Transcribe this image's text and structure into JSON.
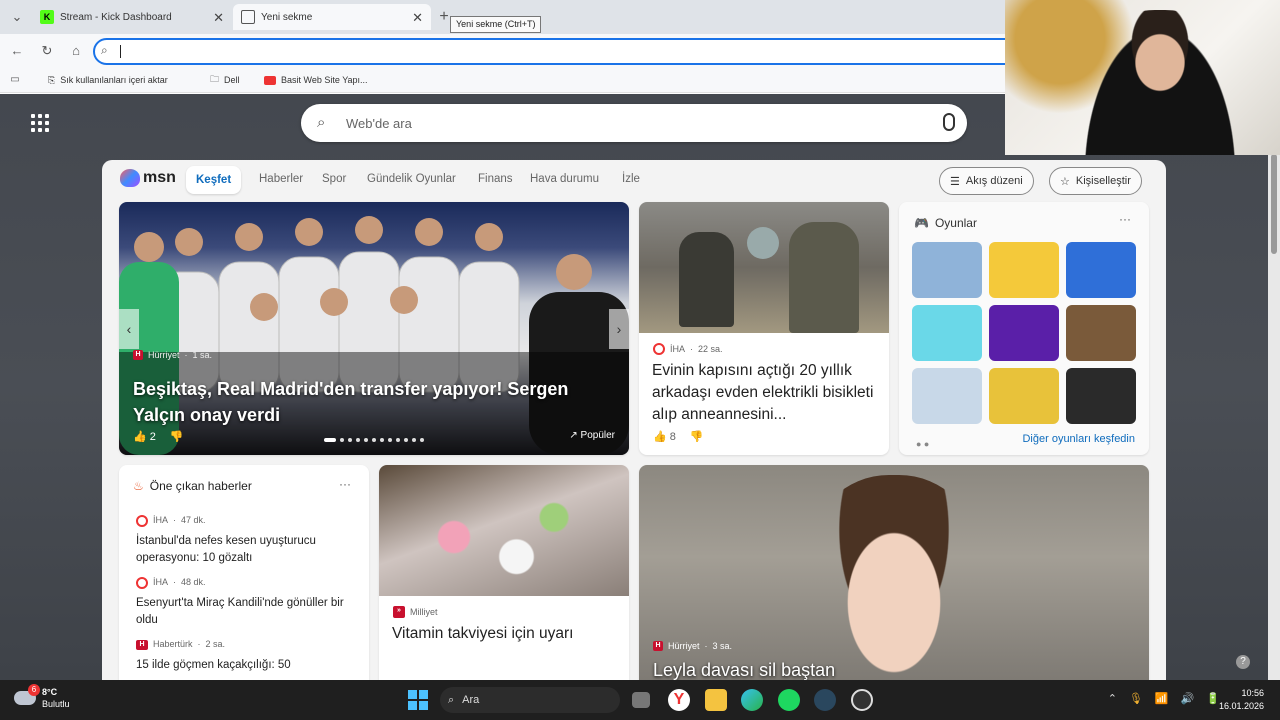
{
  "tabs": [
    {
      "label": "Stream - Kick Dashboard",
      "icon": "kick-icon",
      "color": "#53fc18"
    },
    {
      "label": "Yeni sekme",
      "icon": "newtab-icon"
    }
  ],
  "tooltip": "Yeni sekme (Ctrl+T)",
  "address": {
    "value": ""
  },
  "bookmarks": [
    {
      "label": "Sık kullanılanları içeri aktar",
      "icon": "import-icon"
    },
    {
      "label": "Dell",
      "icon": "folder-icon"
    },
    {
      "label": "Basit Web Site Yapı...",
      "icon": "youtube-icon"
    }
  ],
  "search": {
    "placeholder": "Web'de ara"
  },
  "msn": {
    "logo": "msn",
    "nav": [
      "Keşfet",
      "Haberler",
      "Spor",
      "Gündelik Oyunlar",
      "Finans",
      "Hava durumu",
      "İzle"
    ],
    "buttons": {
      "layout": "Akış düzeni",
      "personalize": "Kişiselleştir"
    }
  },
  "hero": {
    "source": "Hürriyet",
    "age": "1 sa.",
    "title": "Beşiktaş, Real Madrid'den transfer yapıyor! Sergen Yalçın onay verdi",
    "likes": "2",
    "popular": "Popüler"
  },
  "card2": {
    "source": "İHA",
    "age": "22 sa.",
    "title": "Evinin kapısını açtığı 20 yıllık arkadaşı evden elektrikli bisikleti alıp anneannesini...",
    "likes": "8"
  },
  "games": {
    "title": "Oyunlar",
    "more": "Diğer oyunları keşfedin",
    "tiles": [
      "#8fb3d9",
      "#f4c93a",
      "#2f6fd8",
      "#6ad8e8",
      "#5a1fa8",
      "#7a5a3a",
      "#c8d8e8",
      "#e8c23a",
      "#2a2a2a"
    ]
  },
  "topnews": {
    "title": "Öne çıkan haberler",
    "items": [
      {
        "source": "İHA",
        "age": "47 dk.",
        "title": "İstanbul'da nefes kesen uyuşturucu operasyonu: 10 gözaltı"
      },
      {
        "source": "İHA",
        "age": "48 dk.",
        "title": "Esenyurt'ta Miraç Kandili'nde gönüller bir oldu"
      },
      {
        "source": "Habertürk",
        "age": "2 sa.",
        "title": "15 ilde göçmen kaçakçılığı: 50"
      }
    ]
  },
  "card5": {
    "source": "Milliyet",
    "title": "Vitamin takviyesi için uyarı"
  },
  "card6": {
    "source": "Hürriyet",
    "age": "3 sa.",
    "title": "Leyla davası sil baştan"
  },
  "taskbar": {
    "temp": "8°C",
    "weather": "Bulutlu",
    "badge": "6",
    "search": "Ara",
    "time": "10:56",
    "date": "16.01.2026"
  }
}
